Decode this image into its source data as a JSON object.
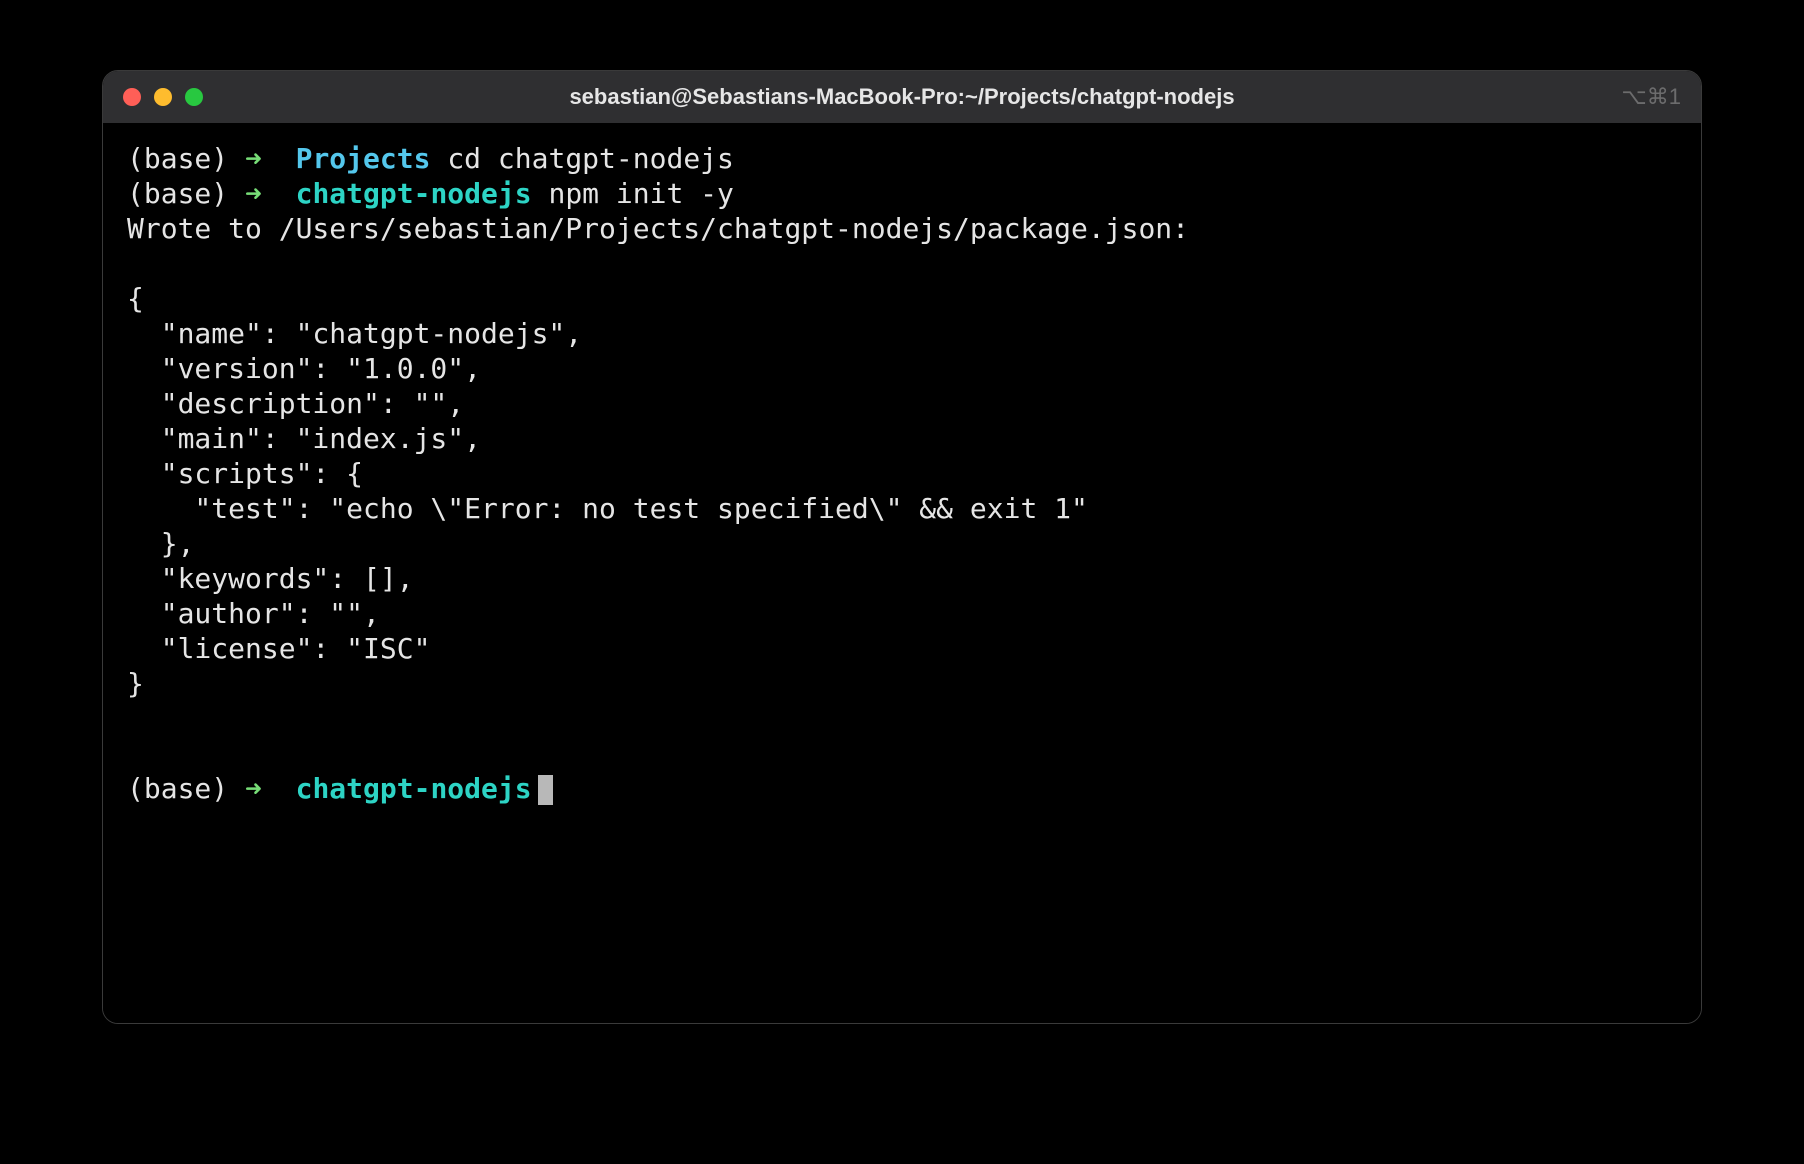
{
  "window": {
    "title": "sebastian@Sebastians-MacBook-Pro:~/Projects/chatgpt-nodejs",
    "shortcut": "⌥⌘1"
  },
  "prompt": {
    "env": "(base)",
    "arrow": "➜"
  },
  "lines": {
    "l1_dir": "Projects",
    "l1_cmd": "cd chatgpt-nodejs",
    "l2_dir": "chatgpt-nodejs",
    "l2_cmd": "npm init -y",
    "l3": "Wrote to /Users/sebastian/Projects/chatgpt-nodejs/package.json:",
    "pkg_open": "{",
    "pkg_name": "  \"name\": \"chatgpt-nodejs\",",
    "pkg_version": "  \"version\": \"1.0.0\",",
    "pkg_description": "  \"description\": \"\",",
    "pkg_main": "  \"main\": \"index.js\",",
    "pkg_scripts_open": "  \"scripts\": {",
    "pkg_scripts_test": "    \"test\": \"echo \\\"Error: no test specified\\\" && exit 1\"",
    "pkg_scripts_close": "  },",
    "pkg_keywords": "  \"keywords\": [],",
    "pkg_author": "  \"author\": \"\",",
    "pkg_license": "  \"license\": \"ISC\"",
    "pkg_close": "}",
    "last_dir": "chatgpt-nodejs"
  }
}
